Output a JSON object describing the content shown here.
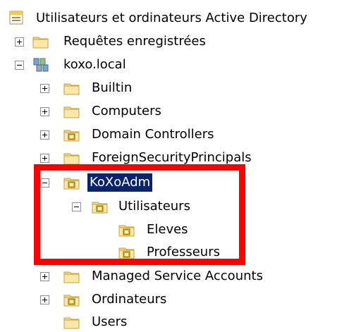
{
  "tree": {
    "root": {
      "label": "Utilisateurs et ordinateurs Active Directory",
      "icon": "ad-console-icon"
    },
    "saved_queries": {
      "label": "Requêtes enregistrées",
      "icon": "folder-icon",
      "state": "collapsed"
    },
    "domain": {
      "label": "koxo.local",
      "icon": "domain-icon",
      "state": "expanded"
    },
    "children": [
      {
        "label": "Builtin",
        "icon": "folder-icon",
        "state": "collapsed"
      },
      {
        "label": "Computers",
        "icon": "folder-icon",
        "state": "collapsed"
      },
      {
        "label": "Domain Controllers",
        "icon": "ou-icon",
        "state": "collapsed"
      },
      {
        "label": "ForeignSecurityPrincipals",
        "icon": "folder-icon",
        "state": "collapsed"
      }
    ],
    "koxoadm": {
      "label": "KoXoAdm",
      "icon": "ou-icon",
      "state": "expanded",
      "selected": true
    },
    "utilisateurs": {
      "label": "Utilisateurs",
      "icon": "ou-icon",
      "state": "expanded"
    },
    "eleves": {
      "label": "Eleves",
      "icon": "ou-icon"
    },
    "professeurs": {
      "label": "Professeurs",
      "icon": "ou-icon"
    },
    "more": [
      {
        "label": "Managed Service Accounts",
        "icon": "folder-icon",
        "state": "collapsed"
      },
      {
        "label": "Ordinateurs",
        "icon": "ou-icon",
        "state": "collapsed"
      },
      {
        "label": "Users",
        "icon": "folder-icon"
      }
    ]
  },
  "colors": {
    "highlight": "#ff0000",
    "selection": "#0a246a",
    "folder": "#f5d78a"
  }
}
